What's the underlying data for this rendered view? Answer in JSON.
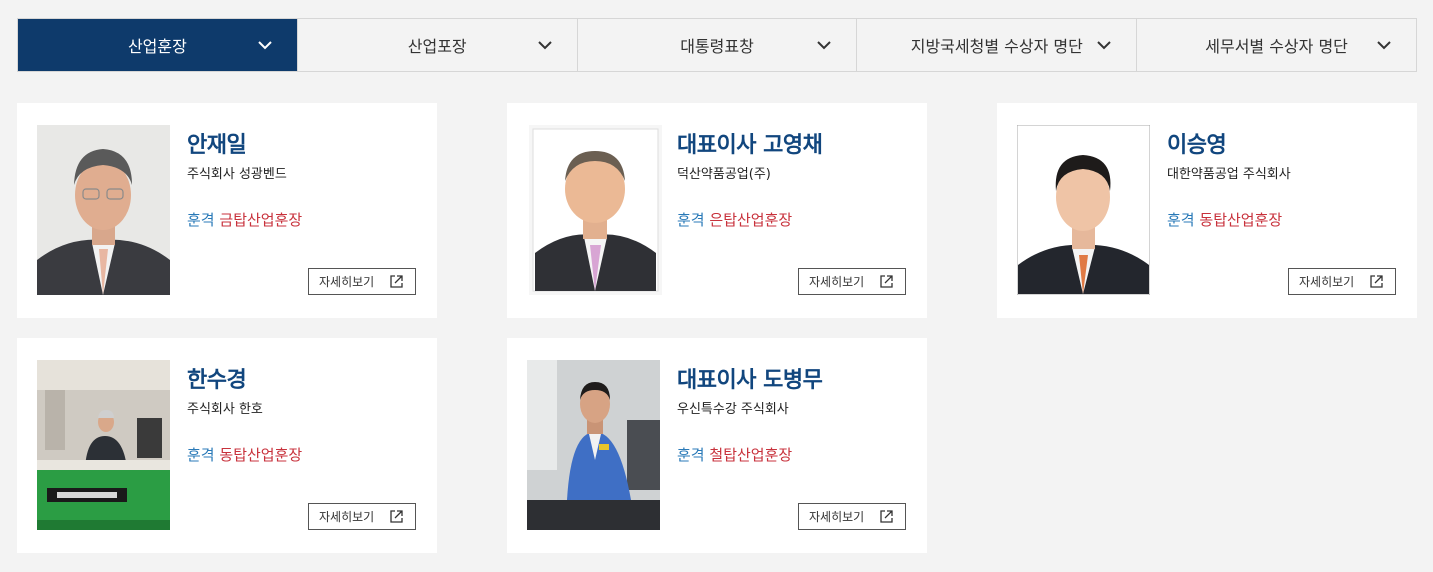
{
  "tabs": [
    {
      "label": "산업훈장",
      "active": true
    },
    {
      "label": "산업포장",
      "active": false
    },
    {
      "label": "대통령표창",
      "active": false
    },
    {
      "label": "지방국세청별 수상자 명단",
      "active": false
    },
    {
      "label": "세무서별 수상자 명단",
      "active": false
    }
  ],
  "detail_label": "자세히보기",
  "cards": [
    {
      "name": "안재일",
      "company": "주식회사 성광벤드",
      "award_prefix": "훈격",
      "award_medal": "금탑산업훈장"
    },
    {
      "name": "대표이사 고영채",
      "company": "덕산약품공업(주)",
      "award_prefix": "훈격",
      "award_medal": "은탑산업훈장"
    },
    {
      "name": "이승영",
      "company": "대한약품공업 주식회사",
      "award_prefix": "훈격",
      "award_medal": "동탑산업훈장"
    },
    {
      "name": "한수경",
      "company": "주식회사 한호",
      "award_prefix": "훈격",
      "award_medal": "동탑산업훈장"
    },
    {
      "name": "대표이사 도병무",
      "company": "우신특수강 주식회사",
      "award_prefix": "훈격",
      "award_medal": "철탑산업훈장"
    }
  ],
  "colors": {
    "active_tab": "#0e3a6b",
    "name": "#11467e",
    "award_prefix": "#2a7ab8",
    "award_medal": "#c8323c"
  }
}
